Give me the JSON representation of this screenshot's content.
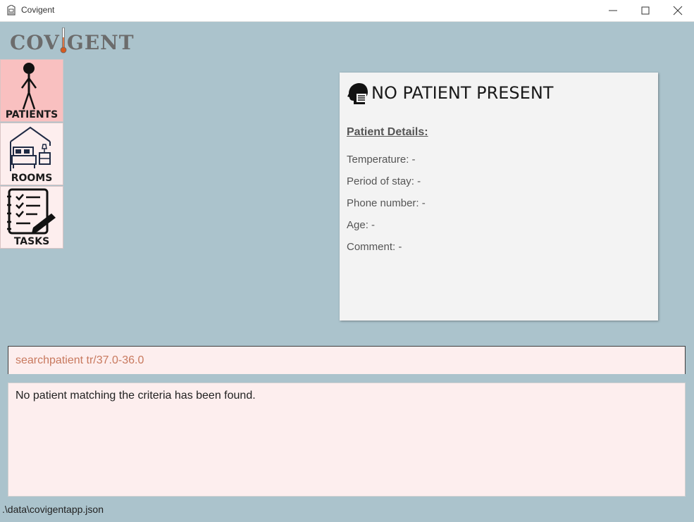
{
  "window": {
    "title": "Covigent",
    "icon": "app-icon",
    "controls": [
      "minimize-icon",
      "maximize-icon",
      "close-icon"
    ]
  },
  "logo": {
    "left_text": "COV",
    "right_text": "GENT",
    "icon": "thermometer-icon"
  },
  "nav": [
    {
      "label": "PATIENTS",
      "icon": "person-icon",
      "active": true
    },
    {
      "label": "ROOMS",
      "icon": "bedroom-icon",
      "active": false
    },
    {
      "label": "TASKS",
      "icon": "checklist-icon",
      "active": false
    }
  ],
  "patient_card": {
    "icon": "patient-head-icon",
    "title": "NO PATIENT PRESENT",
    "section_heading": "Patient Details:",
    "fields": [
      {
        "label": "Temperature:",
        "value": "-"
      },
      {
        "label": "Period of stay:",
        "value": "-"
      },
      {
        "label": "Phone number:",
        "value": "-"
      },
      {
        "label": "Age:",
        "value": "-"
      },
      {
        "label": "Comment:",
        "value": "-"
      }
    ]
  },
  "command": {
    "value": "searchpatient tr/37.0-36.0"
  },
  "result": {
    "message": "No patient matching the criteria has been found."
  },
  "status": {
    "path": ".\\data\\covigentapp.json"
  },
  "colors": {
    "background": "#abc3cc",
    "active_nav": "#f9c0c0",
    "panel": "#fdeeee",
    "command_text": "#c8795e"
  }
}
